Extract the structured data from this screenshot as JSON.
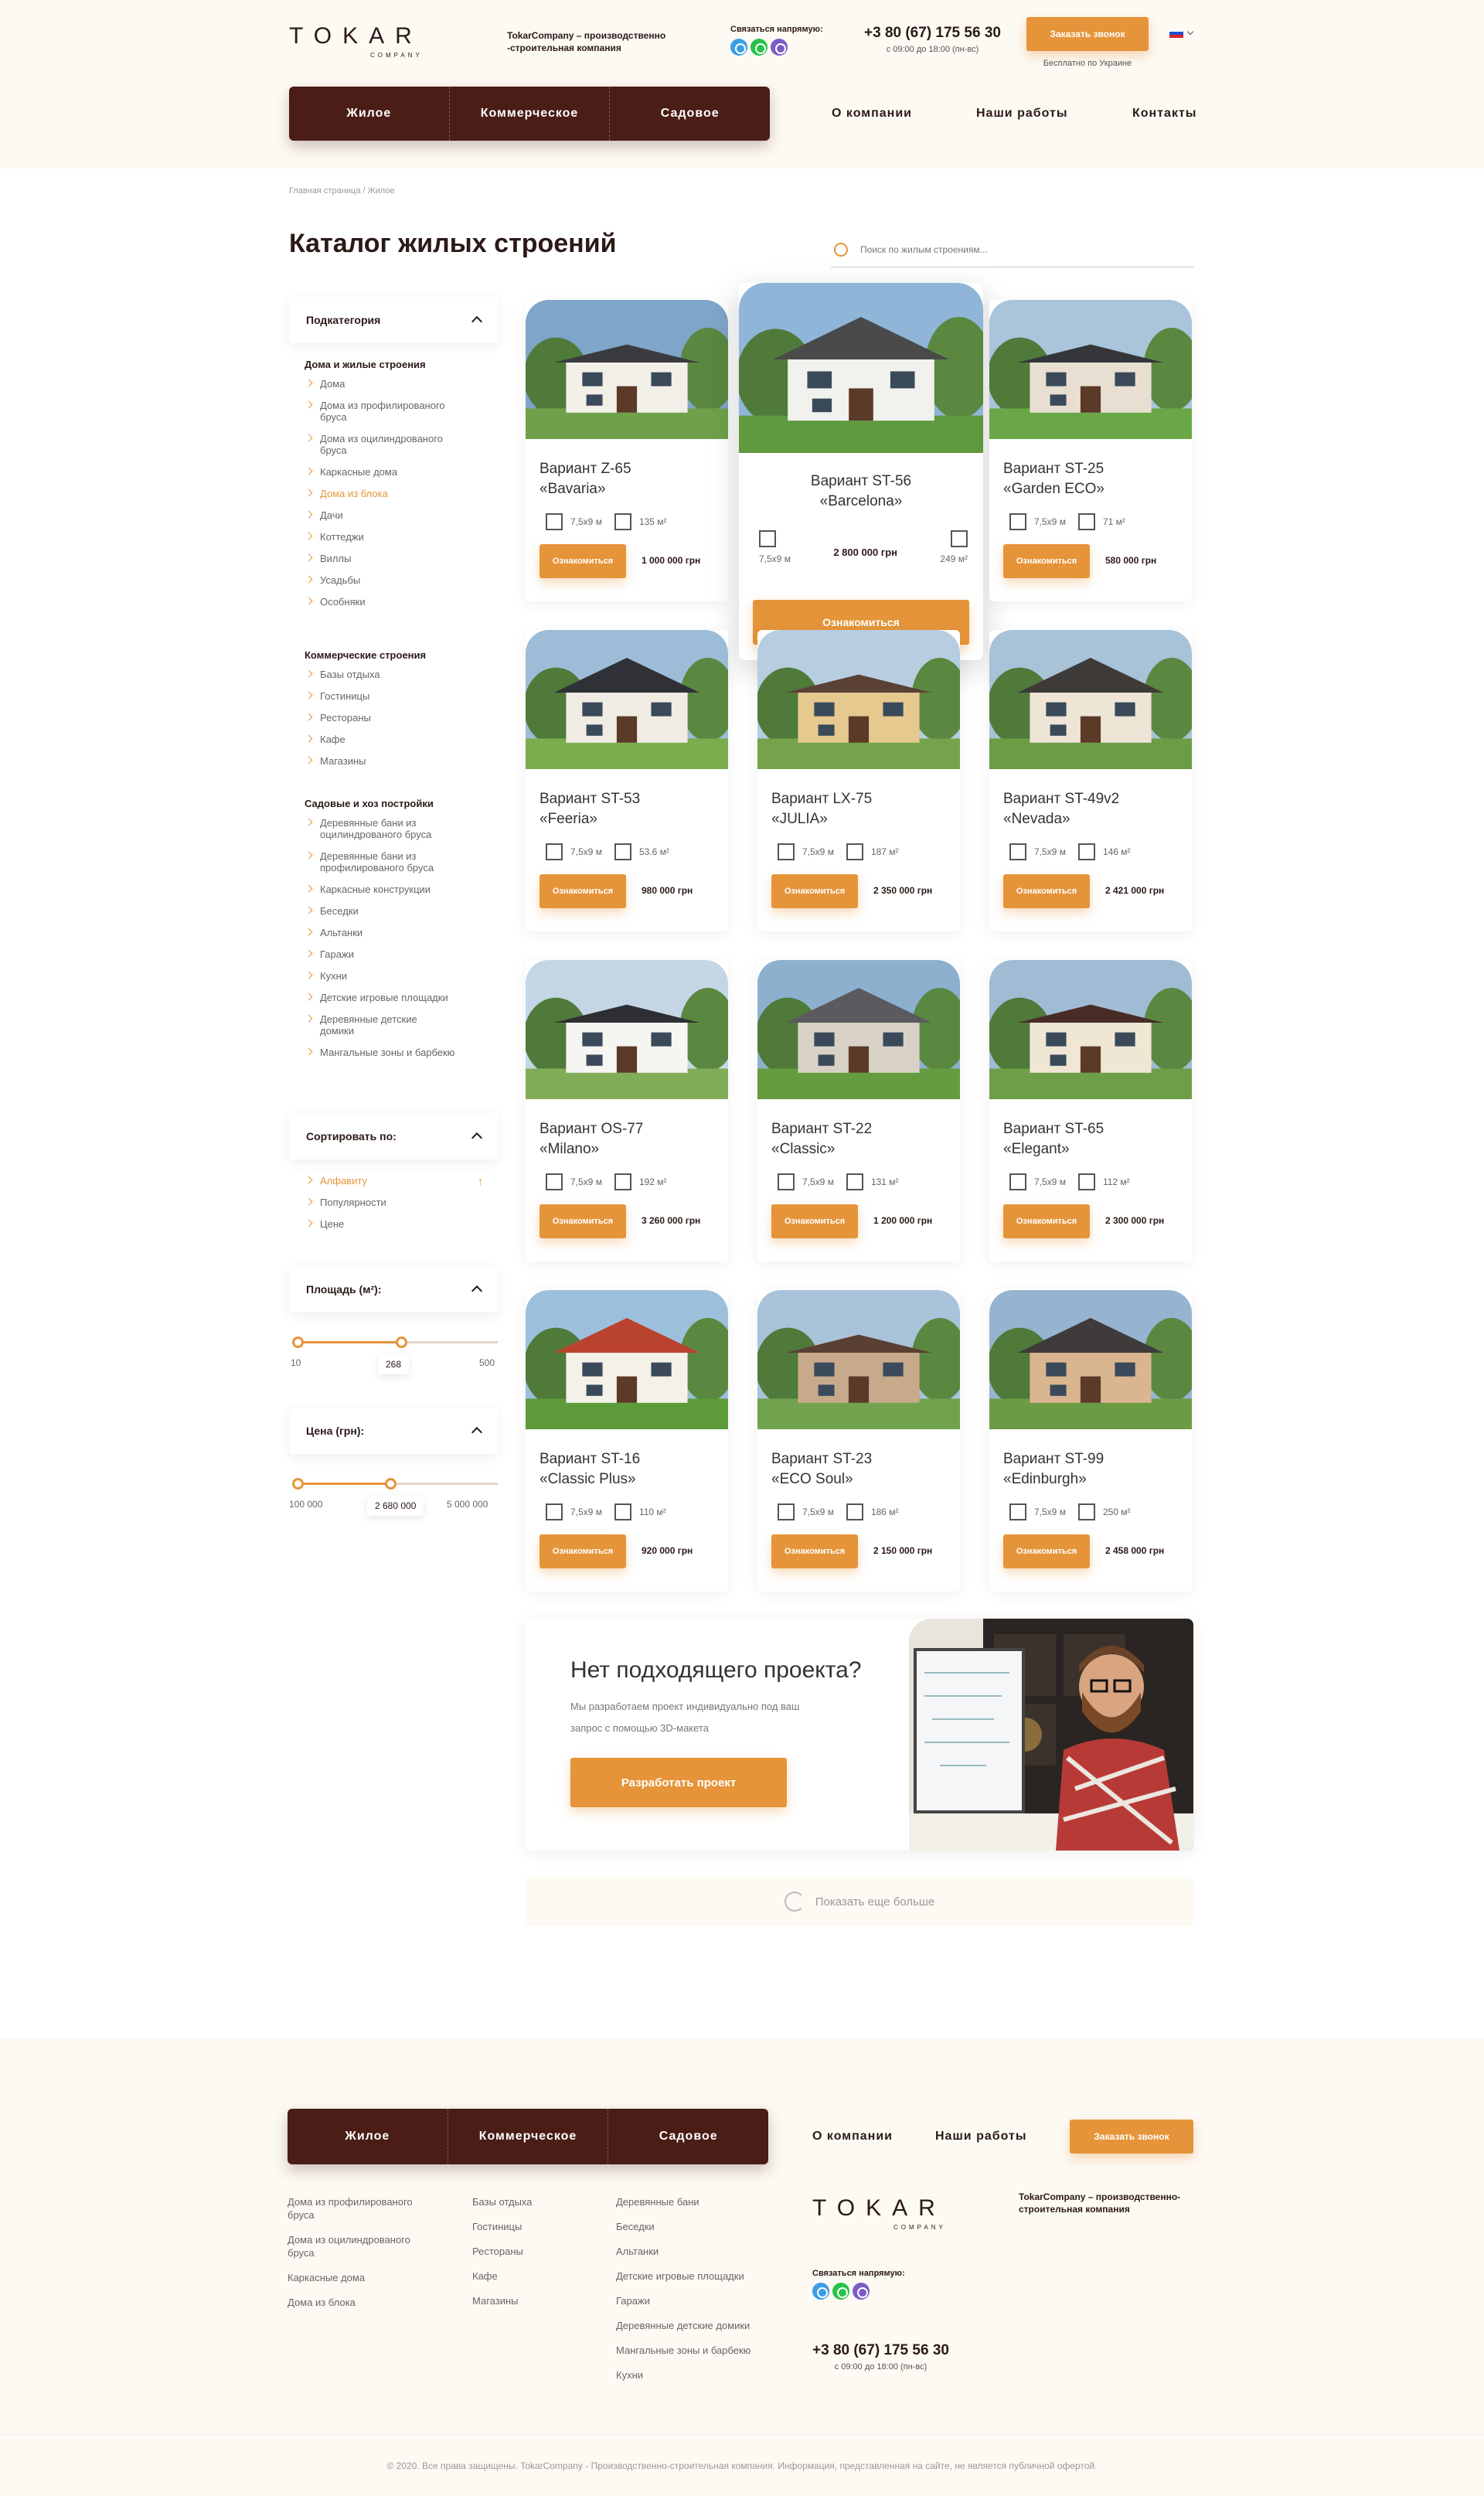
{
  "header": {
    "logo_text": "TOKAR",
    "logo_sub": "COMPANY",
    "tagline_line1": "TokarCompany – производственно",
    "tagline_line2": "-строительная компания",
    "contact_label": "Связаться напрямую:",
    "phone": "+3 80 (67) 175 56 30",
    "hours": "с 09:00 до 18:00 (пн-вс)",
    "callback_label": "Заказать звонок",
    "free_note": "Бесплатно по Украине",
    "lang": "RU"
  },
  "nav": {
    "dark": [
      "Жилое",
      "Коммерческое",
      "Садовое"
    ],
    "light": [
      "О компании",
      "Наши работы",
      "Контакты"
    ]
  },
  "breadcrumb": "Главная страница / Жилое",
  "page_title": "Каталог жилых строений",
  "search_placeholder": "Поиск по жилым строениям...",
  "filters": {
    "subcategory_title": "Подкатегория",
    "groups": [
      {
        "title": "Дома и жилые строения",
        "items": [
          "Дома",
          "Дома из профилированого бруса",
          "Дома из оцилиндрованого бруса",
          "Каркасные дома",
          "Дома из блока",
          "Дачи",
          "Коттеджи",
          "Виллы",
          "Усадьбы",
          "Особняки"
        ]
      },
      {
        "title": "Коммерческие строения",
        "items": [
          "Базы отдыха",
          "Гостиницы",
          "Рестораны",
          "Кафе",
          "Магазины"
        ]
      },
      {
        "title": "Садовые и хоз постройки",
        "items": [
          "Деревянные бани из оцилиндрованого бруса",
          "Деревянные бани из профилированого бруса",
          "Каркасные конструкции",
          "Беседки",
          "Альтанки",
          "Гаражи",
          "Кухни",
          "Детские игровые площадки",
          "Деревянные детские домики",
          "Мангальные зоны и барбекю"
        ]
      }
    ],
    "sort_title": "Сортировать по:",
    "sort_items": [
      "Алфавиту",
      "Популярности",
      "Цене"
    ],
    "area_title": "Площадь (м²):",
    "area_min": "10",
    "area_value": "268",
    "area_max": "500",
    "area_fraction": 0.523,
    "price_title": "Цена (грн):",
    "price_min": "100 000",
    "price_value": "2 680 000",
    "price_max": "5 000 000",
    "price_fraction": 0.47
  },
  "cards": [
    {
      "title1": "Вариант Z-65",
      "title2": "«Bavaria»",
      "size": "7,5x9 м",
      "area": "135 м²",
      "price": "1 000 000 грн"
    },
    {
      "title1": "Вариант ST-56",
      "title2": "«Barcelona»",
      "size": "7,5x9 м",
      "area": "249 м²",
      "price": "2 800 000 грн"
    },
    {
      "title1": "Вариант ST-25",
      "title2": "«Garden ECO»",
      "size": "7,5x9 м",
      "area": "71 м²",
      "price": "580 000 грн"
    },
    {
      "title1": "Вариант ST-53",
      "title2": "«Feeria»",
      "size": "7,5x9 м",
      "area": "53.6 м²",
      "price": "980 000 грн"
    },
    {
      "title1": "Вариант LX-75",
      "title2": "«JULIA»",
      "size": "7,5x9 м",
      "area": "187 м²",
      "price": "2 350 000 грн"
    },
    {
      "title1": "Вариант ST-49v2",
      "title2": "«Nevada»",
      "size": "7,5x9 м",
      "area": "146 м²",
      "price": "2 421 000 грн"
    },
    {
      "title1": "Вариант OS-77",
      "title2": "«Milano»",
      "size": "7,5x9 м",
      "area": "192 м²",
      "price": "3 260 000 грн"
    },
    {
      "title1": "Вариант ST-22",
      "title2": "«Classic»",
      "size": "7,5x9 м",
      "area": "131 м²",
      "price": "1 200 000 грн"
    },
    {
      "title1": "Вариант ST-65",
      "title2": "«Elegant»",
      "size": "7,5x9 м",
      "area": "112 м²",
      "price": "2 300 000 грн"
    },
    {
      "title1": "Вариант ST-16",
      "title2": "«Classic Plus»",
      "size": "7,5x9 м",
      "area": "110 м²",
      "price": "920 000 грн"
    },
    {
      "title1": "Вариант ST-23",
      "title2": "«ECO Soul»",
      "size": "7,5x9 м",
      "area": "186 м²",
      "price": "2 150 000 грн"
    },
    {
      "title1": "Вариант ST-99",
      "title2": "«Edinburgh»",
      "size": "7,5x9 м",
      "area": "250 м²",
      "price": "2 458 000 грн"
    }
  ],
  "card_button": "Ознакомиться",
  "promo": {
    "title": "Нет подходящего проекта?",
    "desc": "Мы разработаем проект индивидуально под ваш запрос с помощью 3D-макета",
    "button": "Разработать проект"
  },
  "show_more": "Показать еще больше",
  "footer": {
    "nav_dark": [
      "Жилое",
      "Коммерческое",
      "Садовое"
    ],
    "nav_light": [
      "О компании",
      "Наши работы"
    ],
    "callback_label": "Заказать звонок",
    "col1": [
      "Дома из профилированого бруса",
      "Дома из оцилиндрованого бруса",
      "Каркасные дома",
      "Дома из блока"
    ],
    "col2": [
      "Базы отдыха",
      "Гостиницы",
      "Рестораны",
      "Кафе",
      "Магазины"
    ],
    "col3": [
      "Деревянные бани",
      "Беседки",
      "Альтанки",
      "Детские игровые площадки",
      "Гаражи",
      "Деревянные детские домики",
      "Мангальные зоны и барбекю",
      "Кухни"
    ],
    "tagline": "TokarCompany – производственно-строительная компания",
    "contact_label": "Связаться напрямую:",
    "phone": "+3 80 (67) 175 56 30",
    "hours": "с 09:00 до 18:00 (пн-вс)",
    "copyright": "© 2020. Все права защищены. TokarCompany - Производственно-строительная компания. Информация, представленная на сайте, не является публичной офертой."
  },
  "colors": {
    "accent": "#e5943a",
    "dark": "#4a1d16",
    "bg": "#fdf9f3"
  }
}
